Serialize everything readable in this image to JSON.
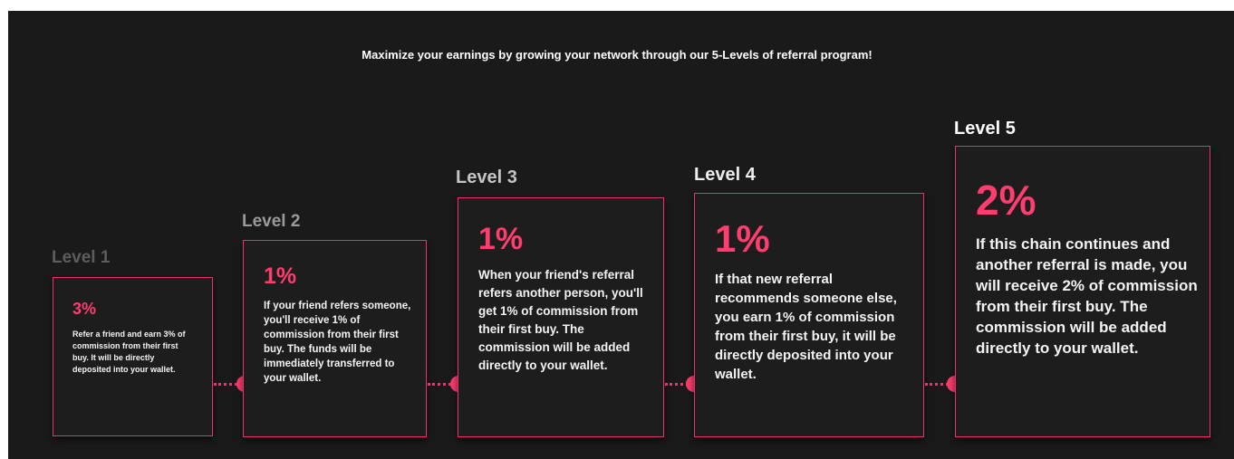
{
  "intro": "Maximize your earnings by growing your network through our 5-Levels of referral program!",
  "colors": {
    "accent": "#ff3d6e",
    "background": "#1b1a1b",
    "card": "#1e1d1e"
  },
  "levels": [
    {
      "title": "Level 1",
      "percent": "3%",
      "text": "Refer a friend and earn 3% of commission from their first buy. It will be directly deposited into your wallet."
    },
    {
      "title": "Level 2",
      "percent": "1%",
      "text": "If your friend refers someone, you'll receive 1% of commission from their first buy. The funds will be immediately transferred to your wallet."
    },
    {
      "title": "Level 3",
      "percent": "1%",
      "text": "When your friend's referral refers another person, you'll get 1% of commission from their first buy. The commission will be added directly to your wallet."
    },
    {
      "title": "Level 4",
      "percent": "1%",
      "text": "If that new referral recommends someone else, you earn 1% of commission from their first buy, it will be directly deposited into your wallet."
    },
    {
      "title": "Level 5",
      "percent": "2%",
      "text": "If this chain continues and another referral is made, you will receive 2% of commission from their first buy. The commission will be added directly to your wallet."
    }
  ]
}
